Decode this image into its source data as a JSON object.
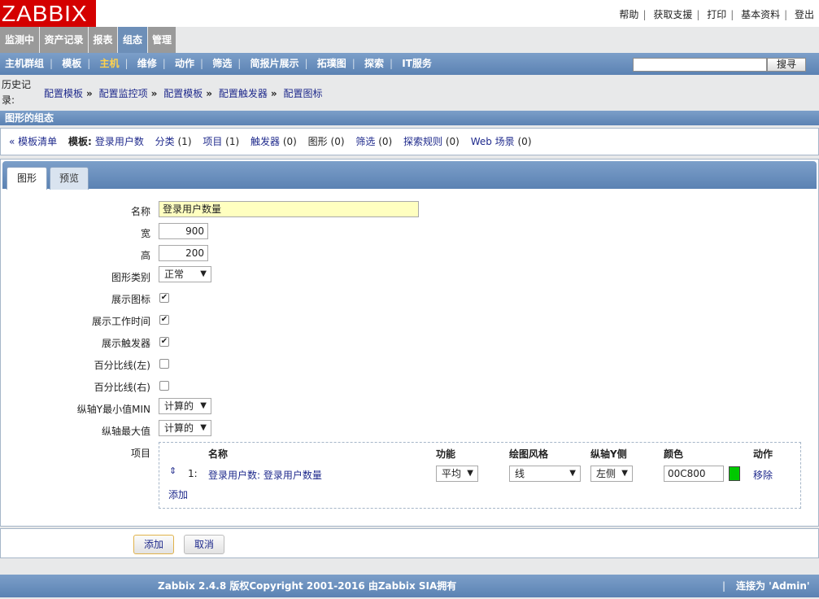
{
  "header": {
    "logo": "ZABBIX",
    "links": [
      "帮助",
      "获取支援",
      "打印",
      "基本资料",
      "登出"
    ]
  },
  "main_menu": [
    "监测中",
    "资产记录",
    "报表",
    "组态",
    "管理"
  ],
  "main_menu_active": "组态",
  "sub_menu": [
    "主机群组",
    "模板",
    "主机",
    "维修",
    "动作",
    "筛选",
    "简报片展示",
    "拓璞图",
    "探索",
    "IT服务"
  ],
  "sub_menu_active": "主机",
  "search": {
    "value": "",
    "button": "搜寻"
  },
  "history": {
    "label": "历史记录:",
    "crumbs": [
      "配置模板",
      "配置监控项",
      "配置模板",
      "配置触发器",
      "配置图标"
    ]
  },
  "section_title": "图形的组态",
  "template_bar": {
    "back": "« 模板清单",
    "template_label": "模板:",
    "template_name": "登录用户数",
    "links": [
      {
        "text": "分类",
        "count": "(1)"
      },
      {
        "text": "项目",
        "count": "(1)"
      },
      {
        "text": "触发器",
        "count": "(0)"
      },
      {
        "text": "图形",
        "count": "(0)",
        "plain": true
      },
      {
        "text": "筛选",
        "count": "(0)"
      },
      {
        "text": "探索规则",
        "count": "(0)"
      },
      {
        "text": "Web 场景",
        "count": "(0)"
      }
    ]
  },
  "form_tabs": [
    "图形",
    "预览"
  ],
  "form": {
    "name_label": "名称",
    "name_value": "登录用户数量",
    "width_label": "宽",
    "width_value": "900",
    "height_label": "高",
    "height_value": "200",
    "type_label": "图形类别",
    "type_value": "正常",
    "show_legend_label": "展示图标",
    "show_legend": true,
    "show_worktime_label": "展示工作时间",
    "show_worktime": true,
    "show_triggers_label": "展示触发器",
    "show_triggers": true,
    "percent_left_label": "百分比线(左)",
    "percent_left": false,
    "percent_right_label": "百分比线(右)",
    "percent_right": false,
    "ymin_label": "纵轴Y最小值MIN",
    "ymin_value": "计算的",
    "ymax_label": "纵轴最大值",
    "ymax_value": "计算的",
    "items_label": "项目"
  },
  "items_table": {
    "headers": [
      "名称",
      "功能",
      "绘图风格",
      "纵轴Y侧",
      "颜色",
      "动作"
    ],
    "rows": [
      {
        "index": "1:",
        "name": "登录用户数: 登录用户数量",
        "function": "平均",
        "style": "线",
        "yaxis": "左侧",
        "color": "00C800",
        "color_hex": "#00c800",
        "action": "移除"
      }
    ],
    "add": "添加"
  },
  "buttons": {
    "add": "添加",
    "cancel": "取消"
  },
  "footer": {
    "copyright": "Zabbix 2.4.8 版权Copyright 2001-2016 由Zabbix SIA拥有",
    "connected": "连接为 'Admin'"
  }
}
